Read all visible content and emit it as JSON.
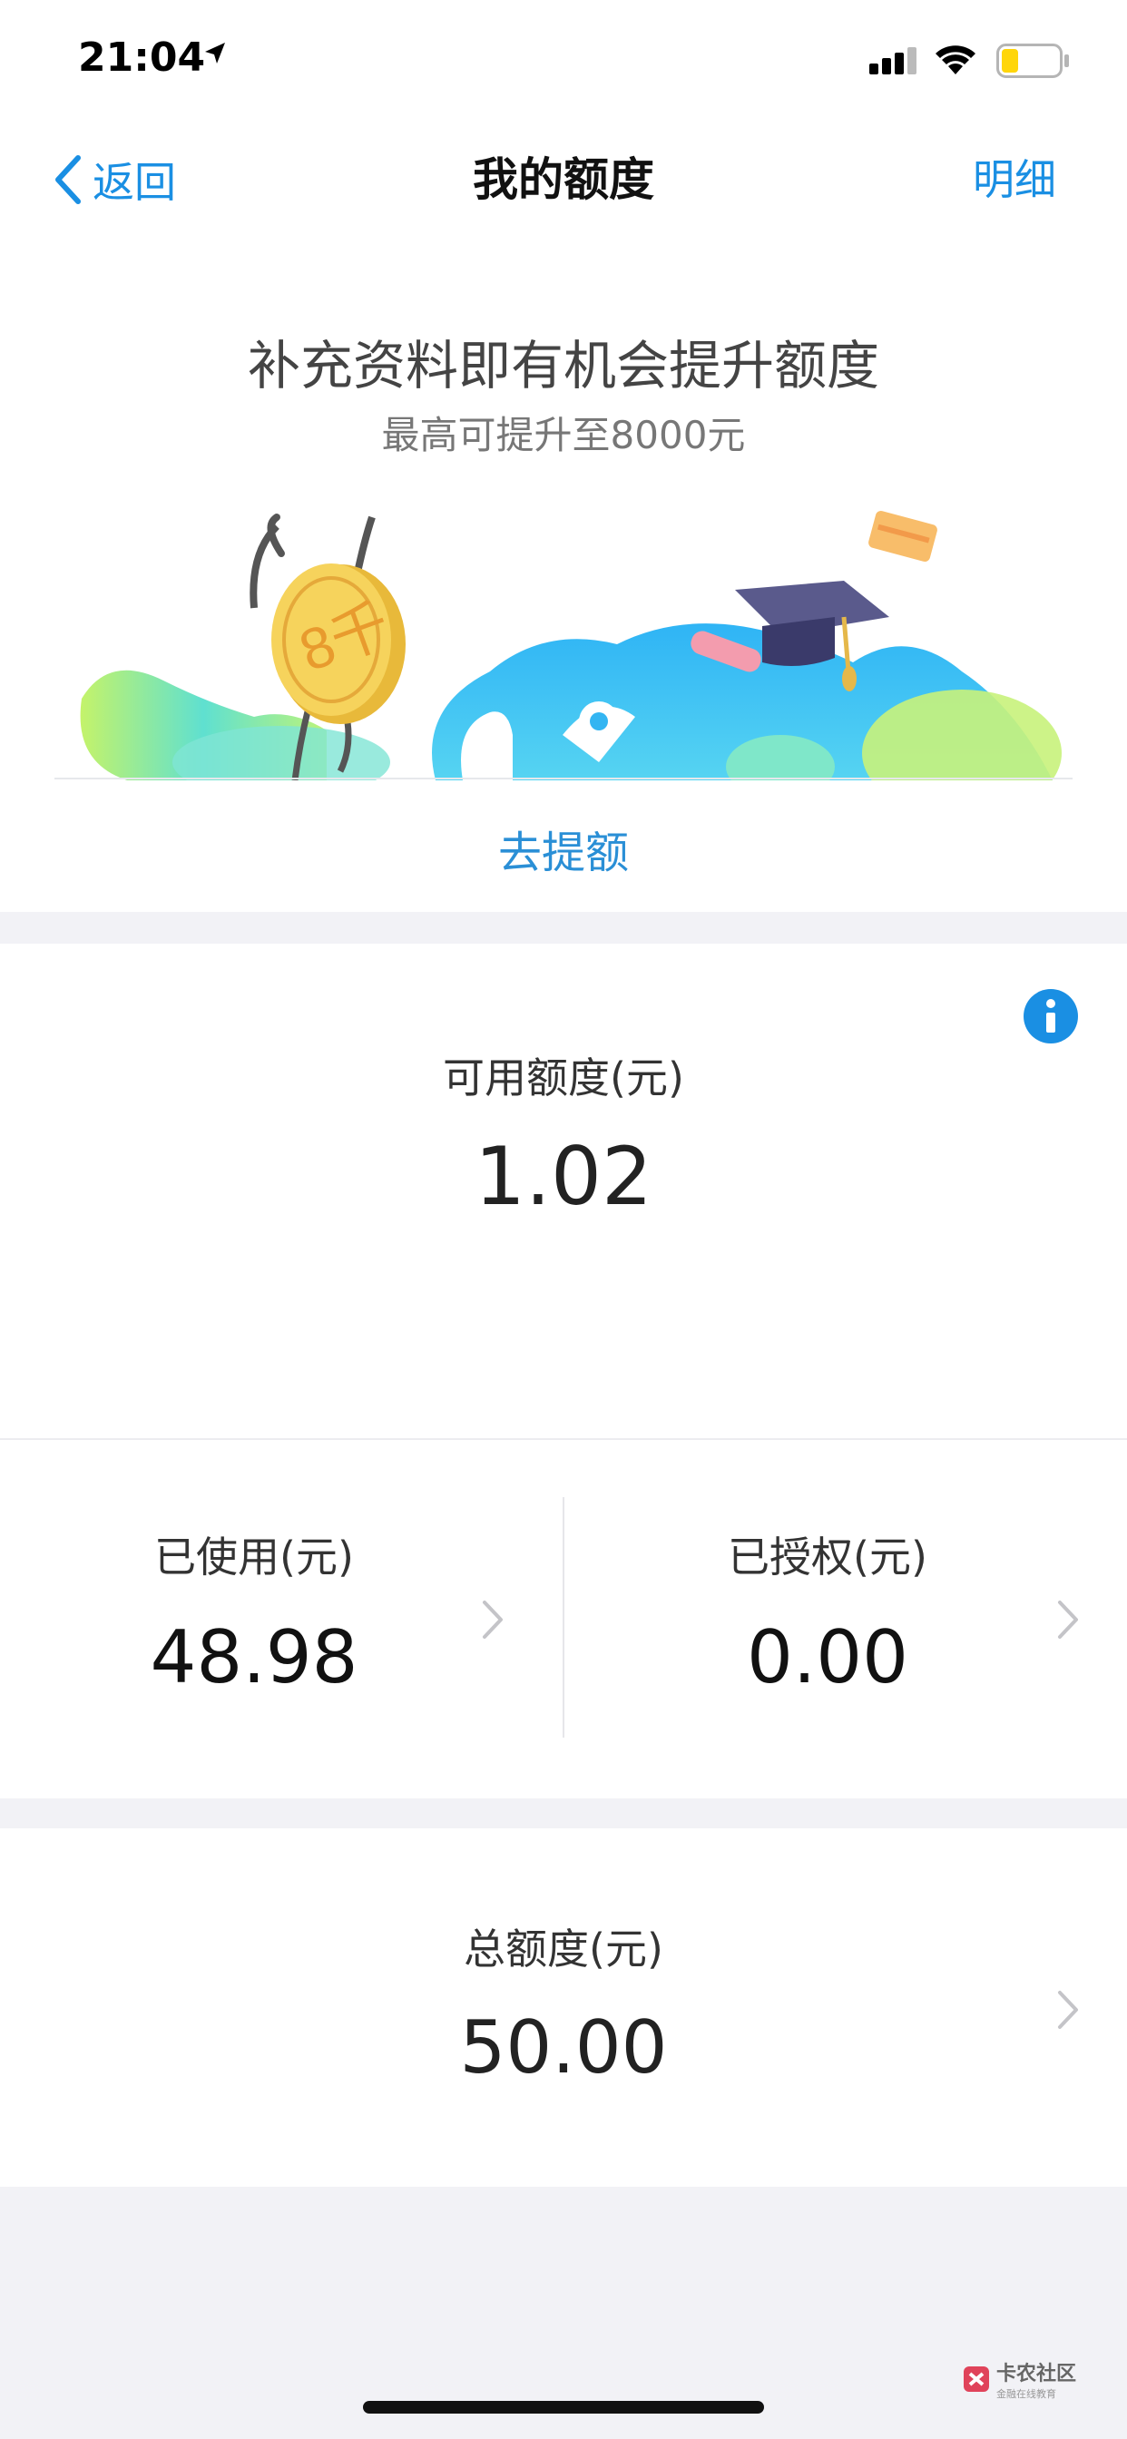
{
  "status_bar": {
    "time": "21:04",
    "icons": [
      "location-arrow-icon",
      "signal-icon",
      "wifi-icon",
      "battery-icon"
    ]
  },
  "nav": {
    "back_label": "返回",
    "title": "我的额度",
    "detail_label": "明细"
  },
  "promo": {
    "title": "补充资料即有机会提升额度",
    "subtitle": "最高可提升至8000元",
    "coin_text": "8千",
    "action_label": "去提额"
  },
  "available": {
    "label": "可用额度(元)",
    "value": "1.02"
  },
  "used": {
    "label": "已使用(元)",
    "value": "48.98"
  },
  "authorized": {
    "label": "已授权(元)",
    "value": "0.00"
  },
  "total": {
    "label": "总额度(元)",
    "value": "50.00"
  },
  "watermark": {
    "main": "卡农社区",
    "sub": "金融在线教育"
  },
  "colors": {
    "accent": "#1a8fe3",
    "background": "#f2f2f6",
    "battery": "#ffd60a"
  }
}
